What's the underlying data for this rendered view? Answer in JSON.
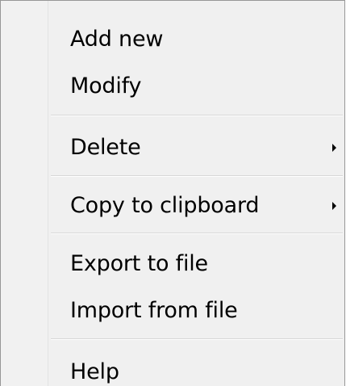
{
  "menu": {
    "items": [
      {
        "label": "Add new",
        "submenu": false
      },
      {
        "label": "Modify",
        "submenu": false
      },
      {
        "label": "Delete",
        "submenu": true
      },
      {
        "label": "Copy to clipboard",
        "submenu": true
      },
      {
        "label": "Export to file",
        "submenu": false
      },
      {
        "label": "Import from file",
        "submenu": false
      },
      {
        "label": "Help",
        "submenu": false
      }
    ],
    "submenu_arrow_icon": "chevron-right-icon",
    "colors": {
      "background": "#f0f0f0",
      "border": "#979797",
      "separator": "#d7d7d7",
      "text": "#000000"
    }
  }
}
